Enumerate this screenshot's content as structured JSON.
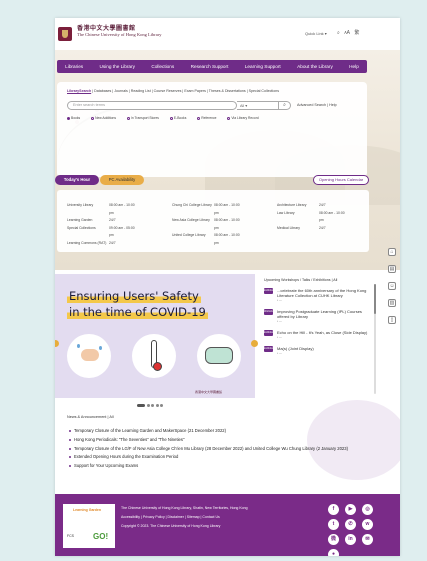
{
  "header": {
    "logo_line1": "香港中文大學圖書館",
    "logo_line2": "The Chinese University of Hong Kong Library",
    "quick_link": "Quick Link ▾",
    "icons": [
      "search-icon",
      "font-size-icon",
      "language-icon"
    ]
  },
  "nav": {
    "items": [
      "Libraries",
      "Using the Library",
      "Collections",
      "Research Support",
      "Learning Support",
      "About the Library",
      "Help"
    ]
  },
  "search": {
    "tabs_prefix": "LibrarySearch",
    "tabs_rest": " | Databases | Journals | Reading List | Course Reserves | Exam Papers | Theses & Dissertations | Special Collections",
    "placeholder": "Enter search terms",
    "scope": "All ▾",
    "go": "⌕",
    "advanced": "Advanced Search | Help",
    "radios": [
      "Books",
      "New Additions",
      "In Transport Stores",
      "E-Books",
      "Reference",
      "Via Library Record"
    ]
  },
  "tabs": {
    "today": "Today's Hour",
    "pc": "PC Availability",
    "opening": "Opening Hours Calendar"
  },
  "hours": {
    "col1": [
      {
        "name": "University Library",
        "time": "08:00 am - 10:00 pm"
      },
      {
        "name": "Learning Garden",
        "time": "24/7"
      },
      {
        "name": "Special Collections",
        "time": "09:00 am - 05:00 pm"
      },
      {
        "name": "Learning Commons (RAT)",
        "time": "24/7"
      }
    ],
    "col2": [
      {
        "name": "Chung Chi College Library",
        "time": "08:00 am - 10:00 pm"
      },
      {
        "name": "New Asia College Library",
        "time": "08:00 am - 10:00 pm"
      },
      {
        "name": "United College Library",
        "time": "08:00 am - 10:00 pm"
      }
    ],
    "col3": [
      {
        "name": "Architecture Library",
        "time": "24/7"
      },
      {
        "name": "Law Library",
        "time": "08:00 am - 10:00 pm"
      },
      {
        "name": "Medical Library",
        "time": "24/7"
      }
    ]
  },
  "banner": {
    "line1": "Ensuring Users' Safety",
    "line2": "in the time of COVID-19",
    "logo": "香港中文大學圖書館"
  },
  "events": {
    "heading": "Upcoming Workshops / Talks / Exhibitions | All",
    "items": [
      {
        "badge": "Exhibition",
        "title": "...celebrate the 60th anniversary of the Hong Kong Literature Collection at CUHK Library",
        "meta": "• —"
      },
      {
        "badge": "Workshop",
        "title": "Improving Postgraduate Learning (IPL) Courses offered by Library",
        "meta": "• —"
      },
      {
        "badge": "Exhibition",
        "title": "Echo on the Hill - It's Yeah, as Close (Side Display)",
        "meta": "• —"
      },
      {
        "badge": "Exhibition",
        "title": "Ma(s) (Joint Display)",
        "meta": "• —"
      }
    ]
  },
  "news": {
    "heading": "News & Announcement  |  All",
    "items": [
      "Temporary Closure of the Learning Garden and MakerSpace (21 December 2022)",
      "Hong Kong Periodicals: \"The Seventies\" and \"The Nineties\"",
      "Temporary Closure of the LG/F of New Asia College Ch'ien Mu Library (28 December 2022) and United College Wu Chung Library (2 January 2023)",
      "Extended Opening Hours during the Examination Period",
      "Support for Your Upcoming Exams"
    ]
  },
  "footer": {
    "address": "The Chinese University of Hong Kong Library, Shatin, New Territories, Hong Kong",
    "links": "Accessibility | Privacy Policy | Disclaimer | Sitemap | Contact Us",
    "copyright": "Copyright © 2023. The Chinese University of Hong Kong Library",
    "logo_a": "Learning Garden",
    "logo_b": "GO!",
    "logo_c": "FCS",
    "social": [
      "facebook-icon",
      "youtube-icon",
      "instagram-icon",
      "twitter-icon",
      "whatsapp-icon",
      "wechat-icon",
      "weibo-icon",
      "linkedin-icon",
      "email-icon",
      "flickr-icon"
    ]
  },
  "float_icons": [
    "library-icon",
    "calendar-icon",
    "person-icon",
    "book-icon",
    "bookmark-icon"
  ],
  "colors": {
    "brand_purple": "#6f2c88",
    "accent_orange": "#e9ad48",
    "footer_purple": "#7a2b88"
  }
}
